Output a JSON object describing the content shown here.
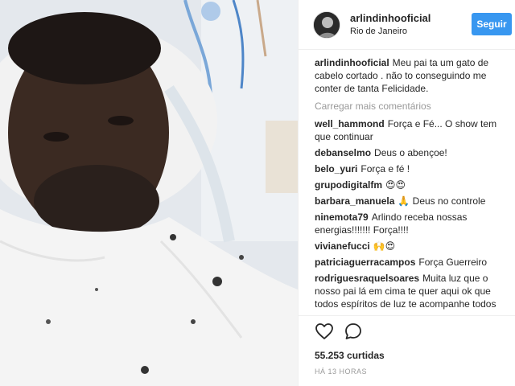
{
  "header": {
    "username": "arlindinhooficial",
    "location": "Rio de Janeiro",
    "follow_label": "Seguir"
  },
  "caption": {
    "username": "arlindinhooficial",
    "text": "Meu pai ta um gato de cabelo cortado . não to conseguindo me conter de tanta Felicidade."
  },
  "load_more_label": "Carregar mais comentários",
  "comments": [
    {
      "username": "well_hammond",
      "text": "Força e Fé... O show tem que continuar"
    },
    {
      "username": "debanselmo",
      "text": "Deus o abençoe!"
    },
    {
      "username": "belo_yuri",
      "text": "Força e fé !"
    },
    {
      "username": "grupodigitalfm",
      "text": "😍😍"
    },
    {
      "username": "barbara_manuela",
      "text": "🙏 Deus no controle"
    },
    {
      "username": "ninemota79",
      "text": "Arlindo receba nossas energias!!!!!!! Força!!!!"
    },
    {
      "username": "vivianefucci",
      "text": "🙌😍"
    },
    {
      "username": "patriciaguerracampos",
      "text": "Força Guerreiro"
    },
    {
      "username": "rodriguesraquelsoares",
      "text": "Muita luz que o nosso pai lá em cima te quer aqui ok que todos espíritos de luz te acompanhe todos"
    }
  ],
  "actions": {
    "like_icon": "heart-icon",
    "comment_icon": "comment-icon",
    "likes_text": "55.253 curtidas",
    "time_text": "HÁ 13 HORAS"
  },
  "colors": {
    "follow_button": "#3897f0",
    "muted_text": "#999999",
    "divider": "#efefef"
  }
}
